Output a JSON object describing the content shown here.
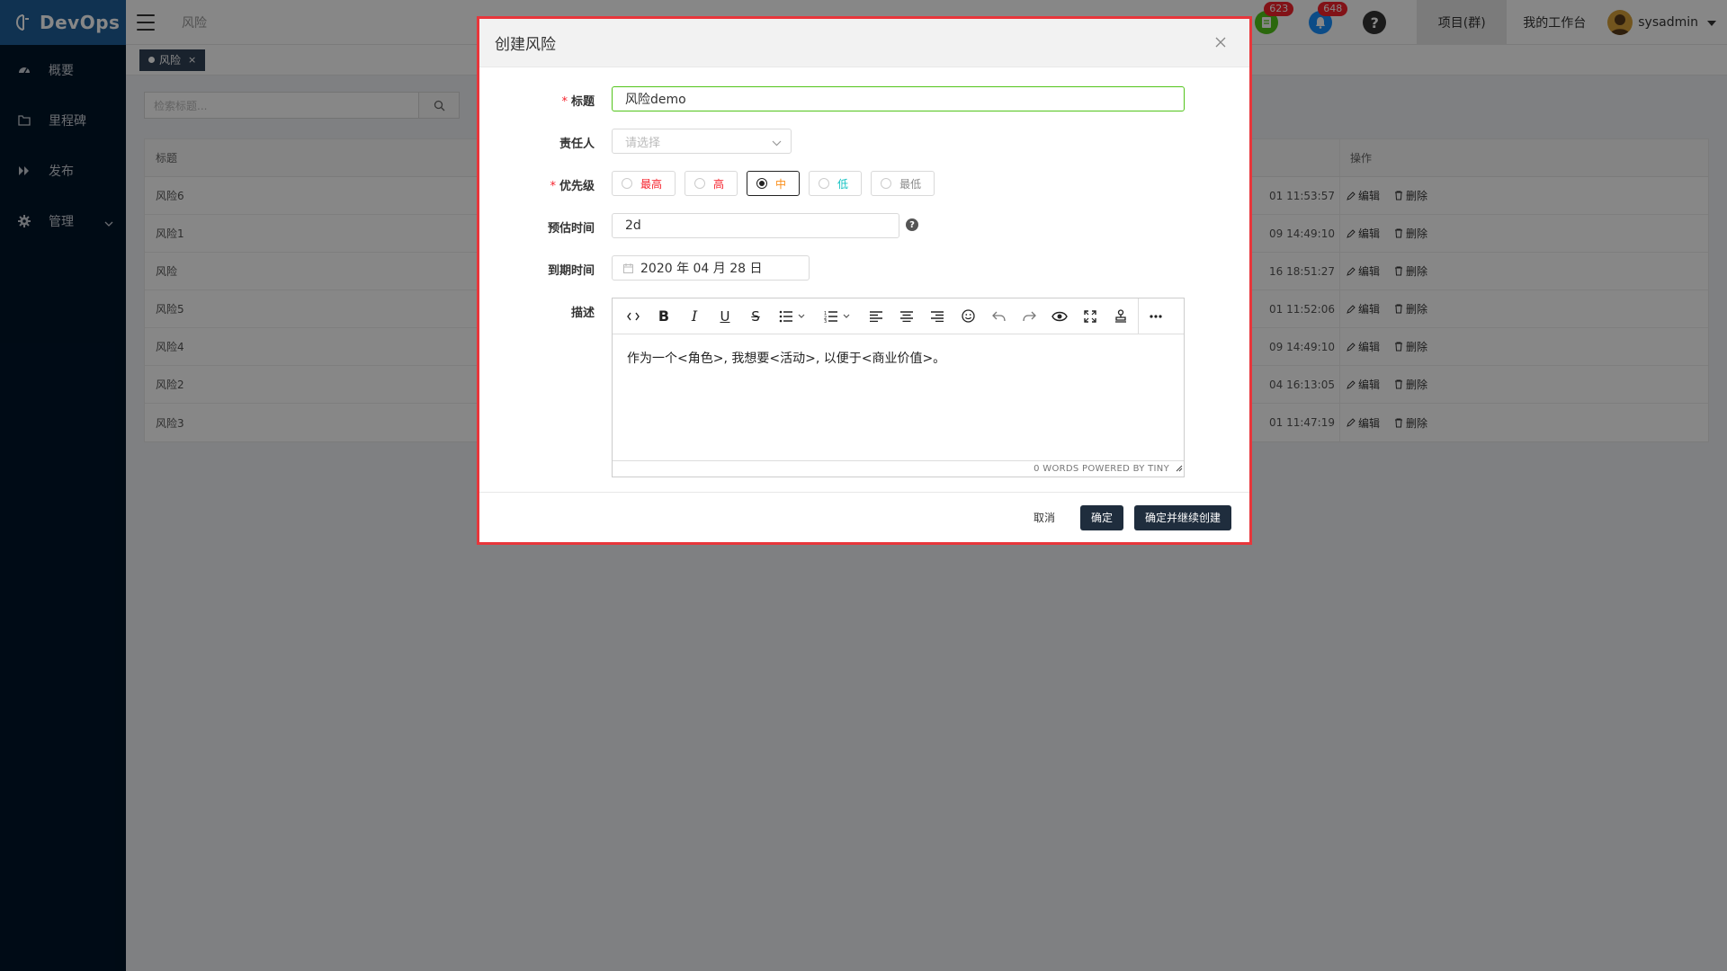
{
  "app": {
    "logo": "DevOps"
  },
  "sidebar": {
    "items": [
      {
        "label": "概要",
        "icon": "dashboard-icon"
      },
      {
        "label": "里程碑",
        "icon": "folder-icon"
      },
      {
        "label": "发布",
        "icon": "forward-icon"
      },
      {
        "label": "管理",
        "icon": "gear-icon"
      }
    ]
  },
  "header": {
    "breadcrumb": "风险",
    "badge_todo": "623",
    "badge_notify": "648",
    "help": "?",
    "project_tab": "项目(群)",
    "workbench": "我的工作台",
    "user": "sysadmin"
  },
  "tagbar": {
    "active_tag": "风险",
    "close": "×"
  },
  "list": {
    "search_placeholder": "检索标题...",
    "col_title": "标题",
    "col_ops": "操作",
    "edit_label": "编辑",
    "delete_label": "删除",
    "rows": [
      {
        "title": "风险6",
        "time": "01 11:53:57"
      },
      {
        "title": "风险1",
        "time": "09 14:49:10"
      },
      {
        "title": "风险",
        "time": "16 18:51:27"
      },
      {
        "title": "风险5",
        "time": "01 11:52:06"
      },
      {
        "title": "风险4",
        "time": "09 14:49:10"
      },
      {
        "title": "风险2",
        "time": "04 16:13:05"
      },
      {
        "title": "风险3",
        "time": "01 11:47:19"
      }
    ]
  },
  "modal": {
    "title": "创建风险",
    "close": "×",
    "labels": {
      "title": "标题",
      "owner": "责任人",
      "priority": "优先级",
      "estimate": "预估时间",
      "due": "到期时间",
      "desc": "描述"
    },
    "required_mark": "*",
    "title_value": "风险demo",
    "owner_placeholder": "请选择",
    "priorities": [
      {
        "label": "最高",
        "color": "#f5222d",
        "selected": false
      },
      {
        "label": "高",
        "color": "#f5222d",
        "selected": false
      },
      {
        "label": "中",
        "color": "#fa8c16",
        "selected": true
      },
      {
        "label": "低",
        "color": "#13c2c2",
        "selected": false
      },
      {
        "label": "最低",
        "color": "#8c8c8c",
        "selected": false
      }
    ],
    "estimate_value": "2d",
    "help": "?",
    "due_value": "2020 年 04 月 28 日",
    "editor_text": "作为一个<角色>, 我想要<活动>, 以便于<商业价值>。",
    "editor_status": "0 WORDS  POWERED BY TINY",
    "footer": {
      "cancel": "取消",
      "ok": "确定",
      "ok_continue": "确定并继续创建"
    }
  }
}
